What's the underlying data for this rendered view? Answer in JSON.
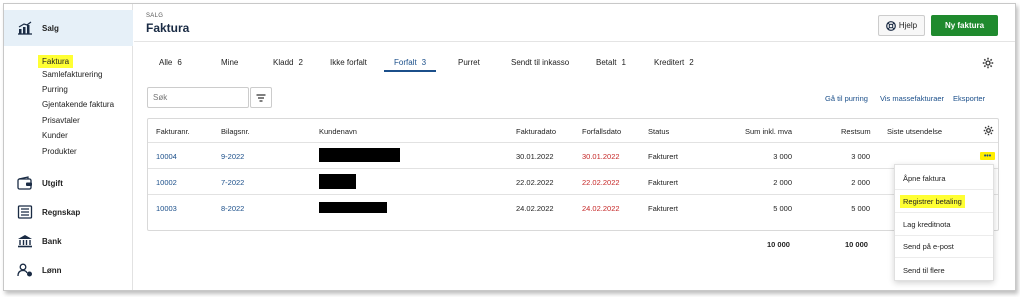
{
  "sidebar": {
    "sections": [
      {
        "label": "Salg",
        "icon": "chart-icon"
      },
      {
        "label": "Utgift",
        "icon": "wallet-icon"
      },
      {
        "label": "Regnskap",
        "icon": "ledger-icon"
      },
      {
        "label": "Bank",
        "icon": "bank-icon"
      },
      {
        "label": "Lønn",
        "icon": "payroll-icon"
      }
    ],
    "sub_items": [
      "Faktura",
      "Samlefakturering",
      "Purring",
      "Gjentakende faktura",
      "Prisavtaler",
      "Kunder",
      "Produkter"
    ]
  },
  "header": {
    "breadcrumb": "SALG",
    "title": "Faktura",
    "help_label": "Hjelp",
    "new_label": "Ny faktura"
  },
  "tabs": [
    {
      "label": "Alle",
      "count": "6"
    },
    {
      "label": "Mine",
      "count": ""
    },
    {
      "label": "Kladd",
      "count": "2"
    },
    {
      "label": "Ikke forfalt",
      "count": ""
    },
    {
      "label": "Forfalt",
      "count": "3"
    },
    {
      "label": "Purret",
      "count": ""
    },
    {
      "label": "Sendt til inkasso",
      "count": ""
    },
    {
      "label": "Betalt",
      "count": "1"
    },
    {
      "label": "Kreditert",
      "count": "2"
    }
  ],
  "toolbar": {
    "search_placeholder": "Søk",
    "link_reminder": "Gå til purring",
    "link_mass": "Vis massefakturaer",
    "link_export": "Eksporter"
  },
  "table": {
    "columns": [
      "Fakturanr.",
      "Bilagsnr.",
      "Kundenavn",
      "Fakturadato",
      "Forfallsdato",
      "Status",
      "Sum inkl. mva",
      "Restsum",
      "Siste utsendelse"
    ],
    "rows": [
      {
        "invoice": "10004",
        "voucher": "9-2022",
        "date": "30.01.2022",
        "due": "30.01.2022",
        "status": "Fakturert",
        "sum": "3 000",
        "rest": "3 000"
      },
      {
        "invoice": "10002",
        "voucher": "7-2022",
        "date": "22.02.2022",
        "due": "22.02.2022",
        "status": "Fakturert",
        "sum": "2 000",
        "rest": "2 000"
      },
      {
        "invoice": "10003",
        "voucher": "8-2022",
        "date": "24.02.2022",
        "due": "24.02.2022",
        "status": "Fakturert",
        "sum": "5 000",
        "rest": "5 000"
      }
    ],
    "totals": {
      "sum": "10 000",
      "rest": "10 000"
    },
    "more_glyph": "•••"
  },
  "context_menu": {
    "items": [
      "Åpne faktura",
      "Registrer betaling",
      "Lag kreditnota",
      "Send på e-post",
      "Send til flere"
    ]
  },
  "colors": {
    "accent_blue": "#1b4f8a",
    "primary_green": "#1f8a2e",
    "overdue_red": "#c62828",
    "highlight_yellow": "#ffff33",
    "active_bg": "#e6f0f8"
  }
}
